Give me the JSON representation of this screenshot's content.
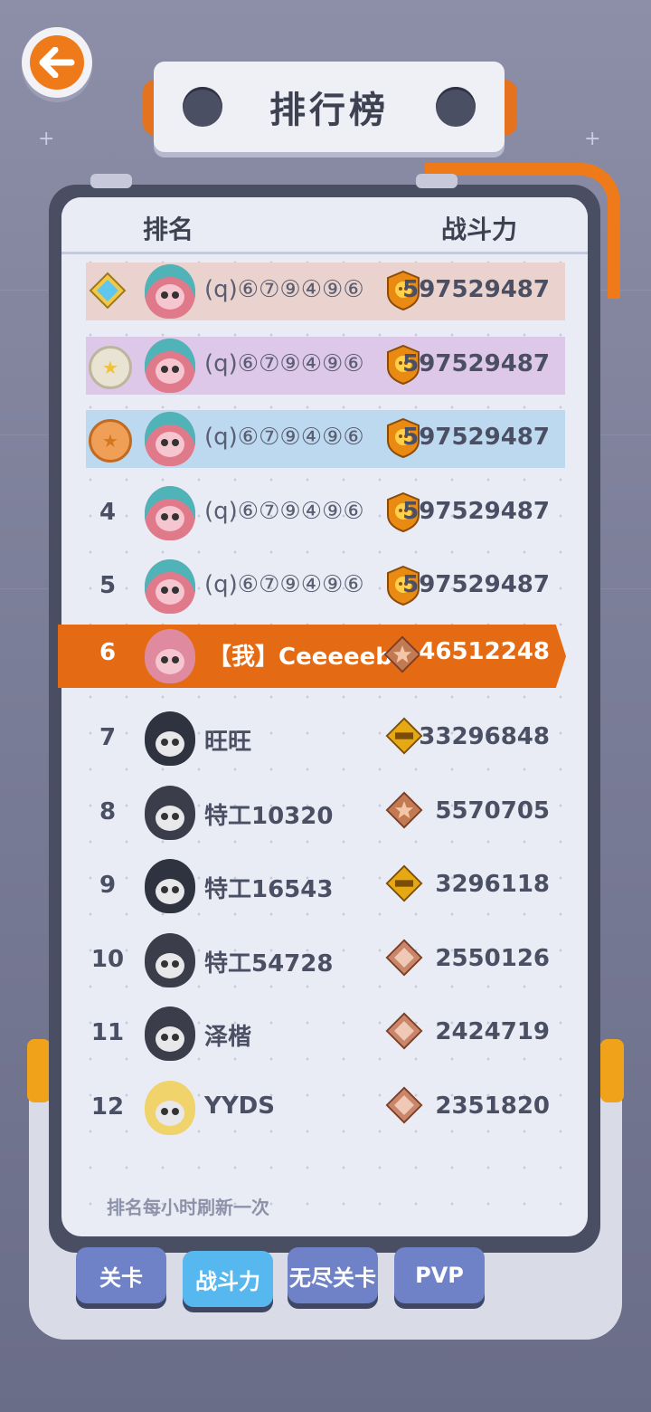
{
  "title": "排行榜",
  "header": {
    "rank_label": "排名",
    "power_label": "战斗力"
  },
  "rows": [
    {
      "rank": "",
      "medal": "diamond",
      "name": "(q)⑥⑦⑨④⑨⑥",
      "power": "597529487",
      "badge": "gold-skull"
    },
    {
      "rank": "",
      "medal": "silver",
      "name": "(q)⑥⑦⑨④⑨⑥",
      "power": "597529487",
      "badge": "gold-skull"
    },
    {
      "rank": "",
      "medal": "bronze",
      "name": "(q)⑥⑦⑨④⑨⑥",
      "power": "597529487",
      "badge": "gold-skull"
    },
    {
      "rank": "4",
      "name": "(q)⑥⑦⑨④⑨⑥",
      "power": "597529487",
      "badge": "gold-skull"
    },
    {
      "rank": "5",
      "name": "(q)⑥⑦⑨④⑨⑥",
      "power": "597529487",
      "badge": "gold-skull"
    },
    {
      "rank": "6",
      "name": "【我】Ceeeeeb",
      "power": "46512248",
      "badge": "bronze-star",
      "me": true
    },
    {
      "rank": "7",
      "name": "旺旺",
      "power": "33296848",
      "badge": "gold-wing"
    },
    {
      "rank": "8",
      "name": "特工10320",
      "power": "5570705",
      "badge": "bronze-star"
    },
    {
      "rank": "9",
      "name": "特工16543",
      "power": "3296118",
      "badge": "gold-wing"
    },
    {
      "rank": "10",
      "name": "特工54728",
      "power": "2550126",
      "badge": "bronze-plain"
    },
    {
      "rank": "11",
      "name": "泽楷",
      "power": "2424719",
      "badge": "bronze-plain"
    },
    {
      "rank": "12",
      "name": "YYDS",
      "power": "2351820",
      "badge": "bronze-plain"
    }
  ],
  "footnote": "排名每小时刷新一次",
  "tabs": [
    {
      "label": "关卡",
      "active": false
    },
    {
      "label": "战斗力",
      "active": true
    },
    {
      "label": "无尽关卡",
      "active": false
    },
    {
      "label": "PVP",
      "active": false
    }
  ],
  "colors": {
    "accent": "#e56a14",
    "row1": "#ead3cf",
    "row2": "#dec8ea",
    "row3": "#bdd9f0",
    "tab_active": "#56b8ef",
    "tab": "#6f82c8"
  }
}
